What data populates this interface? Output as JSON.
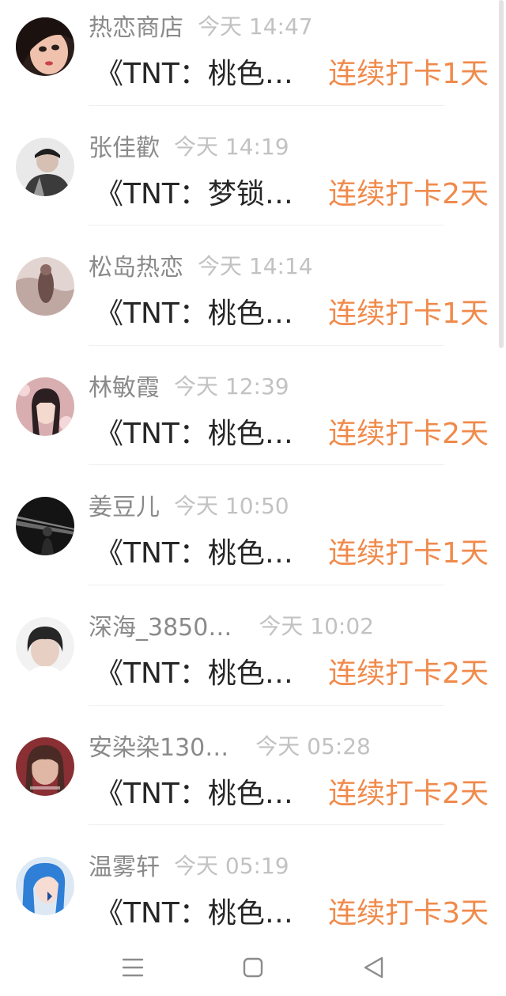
{
  "entries": [
    {
      "name": "热恋商店",
      "time": "今天 14:47",
      "title": "《TNT：桃色…",
      "streak": "连续打卡1天",
      "avatar_colors": [
        "#2a1d1a",
        "#c9786c",
        "#f0c2ae"
      ]
    },
    {
      "name": "张佳歡",
      "time": "今天 14:19",
      "title": "《TNT：梦锁…",
      "streak": "连续打卡2天",
      "avatar_colors": [
        "#e9e9e9",
        "#3b3b3b",
        "#9a9a9a"
      ]
    },
    {
      "name": "松岛热恋",
      "time": "今天 14:14",
      "title": "《TNT：桃色…",
      "streak": "连续打卡1天",
      "avatar_colors": [
        "#bfa7a2",
        "#6d4f4c",
        "#e2d4d0"
      ]
    },
    {
      "name": "林敏霞",
      "time": "今天 12:39",
      "title": "《TNT：桃色…",
      "streak": "连续打卡2天",
      "avatar_colors": [
        "#d9aeb1",
        "#2c1f22",
        "#f4d9cf"
      ]
    },
    {
      "name": "姜豆儿",
      "time": "今天 10:50",
      "title": "《TNT：桃色…",
      "streak": "连续打卡1天",
      "avatar_colors": [
        "#141414",
        "#6a6a6a",
        "#cfcfcf"
      ]
    },
    {
      "name": "深海_3850…",
      "time": "今天 10:02",
      "title": "《TNT：桃色…",
      "streak": "连续打卡2天",
      "avatar_colors": [
        "#f2f2f2",
        "#262626",
        "#e8cfc4"
      ]
    },
    {
      "name": "安染染130…",
      "time": "今天 05:28",
      "title": "《TNT：桃色…",
      "streak": "连续打卡2天",
      "avatar_colors": [
        "#4a2a24",
        "#e0b7a5",
        "#8a2f34"
      ]
    },
    {
      "name": "温雾轩",
      "time": "今天 05:19",
      "title": "《TNT：桃色…",
      "streak": "连续打卡3天",
      "avatar_colors": [
        "#2f7fd6",
        "#dce9f5",
        "#f6dcd2"
      ]
    }
  ],
  "navbar": {
    "menu_icon": "menu-icon",
    "home_icon": "square-home-icon",
    "back_icon": "triangle-back-icon"
  },
  "colors": {
    "streak": "#f08a4b",
    "name": "#8a8a8a",
    "time": "#c2c2c2",
    "title": "#262626"
  }
}
